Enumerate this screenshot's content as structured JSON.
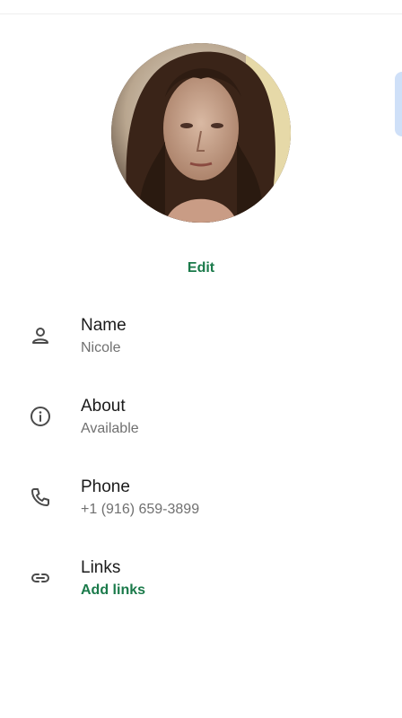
{
  "profile": {
    "edit_label": "Edit",
    "photo_icon": "profile-photo"
  },
  "fields": {
    "name": {
      "title": "Name",
      "value": "Nicole",
      "icon": "person-icon"
    },
    "about": {
      "title": "About",
      "value": "Available",
      "icon": "info-icon"
    },
    "phone": {
      "title": "Phone",
      "value": "+1 (916) 659-3899",
      "icon": "phone-icon"
    },
    "links": {
      "title": "Links",
      "value": "Add links",
      "icon": "link-icon"
    }
  },
  "colors": {
    "accent": "#1a7a4a",
    "title_text": "#1b1b1b",
    "secondary_text": "#707070",
    "icon": "#4a4a4a"
  }
}
